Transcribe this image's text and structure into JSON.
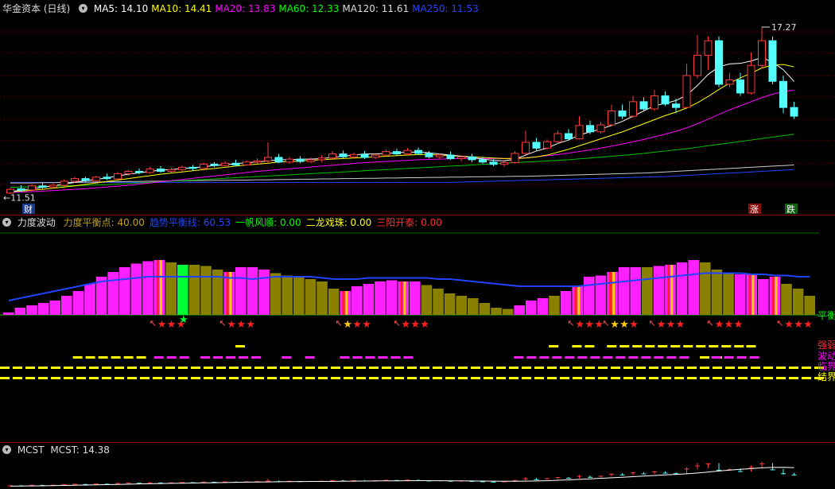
{
  "main": {
    "title": "华金资本 (日线)",
    "ma": [
      {
        "label": "MA5: 14.10",
        "color": "#ffffff"
      },
      {
        "label": "MA10: 14.41",
        "color": "#ffff00"
      },
      {
        "label": "MA20: 13.83",
        "color": "#ff00ff"
      },
      {
        "label": "MA60: 12.33",
        "color": "#00ff00"
      },
      {
        "label": "MA120: 11.61",
        "color": "#dddddd"
      },
      {
        "label": "MA250: 11.53",
        "color": "#2244ff"
      }
    ],
    "high_label": "17.27",
    "low_label": "11.51",
    "markers": {
      "cai": "财",
      "zhang": "涨",
      "die": "跌"
    },
    "candles": [
      [
        11.55,
        11.72,
        11.68,
        11.51
      ],
      [
        11.7,
        11.82,
        11.65,
        11.6
      ],
      [
        11.66,
        11.85,
        11.8,
        11.62
      ],
      [
        11.8,
        11.92,
        11.75,
        11.7
      ],
      [
        11.76,
        11.88,
        11.82,
        11.7
      ],
      [
        11.82,
        12.02,
        11.96,
        11.78
      ],
      [
        11.96,
        12.1,
        12.05,
        11.9
      ],
      [
        12.05,
        12.12,
        11.98,
        11.92
      ],
      [
        11.98,
        12.15,
        12.1,
        11.95
      ],
      [
        12.1,
        12.22,
        12.05,
        12.0
      ],
      [
        12.04,
        12.28,
        12.22,
        12.02
      ],
      [
        12.22,
        12.35,
        12.3,
        12.15
      ],
      [
        12.3,
        12.4,
        12.26,
        12.2
      ],
      [
        12.26,
        12.45,
        12.38,
        12.22
      ],
      [
        12.38,
        12.48,
        12.3,
        12.25
      ],
      [
        12.3,
        12.42,
        12.36,
        12.26
      ],
      [
        12.36,
        12.5,
        12.44,
        12.3
      ],
      [
        12.44,
        12.52,
        12.4,
        12.32
      ],
      [
        12.4,
        12.6,
        12.55,
        12.36
      ],
      [
        12.55,
        12.62,
        12.5,
        12.44
      ],
      [
        12.5,
        12.65,
        12.58,
        12.46
      ],
      [
        12.58,
        12.7,
        12.52,
        12.48
      ],
      [
        12.52,
        12.68,
        12.62,
        12.5
      ],
      [
        12.62,
        12.75,
        12.66,
        12.55
      ],
      [
        12.66,
        13.3,
        12.78,
        12.6
      ],
      [
        12.78,
        12.9,
        12.62,
        12.58
      ],
      [
        12.62,
        12.8,
        12.72,
        12.56
      ],
      [
        12.72,
        12.82,
        12.64,
        12.58
      ],
      [
        12.64,
        12.78,
        12.7,
        12.58
      ],
      [
        12.7,
        12.85,
        12.76,
        12.62
      ],
      [
        12.76,
        13.0,
        12.9,
        12.7
      ],
      [
        12.9,
        13.02,
        12.8,
        12.74
      ],
      [
        12.8,
        12.95,
        12.88,
        12.74
      ],
      [
        12.88,
        13.0,
        12.78,
        12.72
      ],
      [
        12.78,
        12.92,
        12.86,
        12.72
      ],
      [
        12.86,
        13.05,
        12.98,
        12.8
      ],
      [
        12.98,
        13.08,
        12.9,
        12.84
      ],
      [
        12.9,
        13.1,
        13.02,
        12.86
      ],
      [
        13.02,
        13.12,
        12.92,
        12.86
      ],
      [
        12.92,
        13.0,
        12.8,
        12.74
      ],
      [
        12.8,
        12.92,
        12.86,
        12.72
      ],
      [
        12.86,
        12.98,
        12.74,
        12.7
      ],
      [
        12.74,
        12.86,
        12.8,
        12.64
      ],
      [
        12.8,
        12.9,
        12.7,
        12.62
      ],
      [
        12.7,
        12.8,
        12.62,
        12.56
      ],
      [
        12.62,
        12.72,
        12.54,
        12.48
      ],
      [
        12.54,
        12.64,
        12.6,
        12.46
      ],
      [
        12.6,
        13.0,
        12.92,
        12.56
      ],
      [
        12.92,
        13.7,
        13.3,
        12.88
      ],
      [
        13.3,
        13.45,
        13.1,
        13.02
      ],
      [
        13.1,
        13.4,
        13.32,
        13.05
      ],
      [
        13.32,
        13.7,
        13.6,
        13.25
      ],
      [
        13.6,
        13.75,
        13.42,
        13.35
      ],
      [
        13.42,
        14.2,
        13.88,
        13.4
      ],
      [
        13.88,
        14.05,
        13.66,
        13.58
      ],
      [
        13.66,
        14.0,
        13.9,
        13.6
      ],
      [
        13.9,
        14.6,
        14.38,
        13.85
      ],
      [
        14.38,
        14.6,
        14.2,
        14.1
      ],
      [
        14.2,
        14.9,
        14.7,
        14.15
      ],
      [
        14.7,
        14.85,
        14.45,
        14.38
      ],
      [
        14.45,
        15.1,
        14.9,
        14.4
      ],
      [
        14.9,
        15.05,
        14.62,
        14.55
      ],
      [
        14.62,
        14.8,
        14.5,
        14.3
      ],
      [
        14.5,
        16.0,
        15.6,
        14.45
      ],
      [
        15.6,
        17.0,
        16.3,
        15.5
      ],
      [
        16.3,
        16.95,
        16.8,
        15.8
      ],
      [
        16.8,
        16.95,
        15.3,
        15.2
      ],
      [
        15.3,
        15.7,
        15.45,
        15.2
      ],
      [
        15.45,
        15.7,
        15.0,
        14.9
      ],
      [
        15.0,
        16.4,
        15.95,
        14.95
      ],
      [
        15.95,
        17.27,
        16.8,
        15.85
      ],
      [
        16.8,
        16.95,
        15.4,
        15.3
      ],
      [
        15.4,
        15.6,
        14.5,
        14.3
      ],
      [
        14.5,
        14.7,
        14.2,
        14.1
      ]
    ],
    "ma5": [
      11.6,
      11.65,
      11.7,
      11.75,
      11.8,
      11.86,
      11.92,
      11.98,
      12.02,
      12.08,
      12.14,
      12.2,
      12.25,
      12.3,
      12.34,
      12.36,
      12.4,
      12.42,
      12.46,
      12.5,
      12.53,
      12.56,
      12.6,
      12.62,
      12.66,
      12.7,
      12.7,
      12.72,
      12.72,
      12.74,
      12.78,
      12.82,
      12.86,
      12.9,
      12.9,
      12.92,
      12.94,
      12.96,
      12.96,
      12.94,
      12.9,
      12.86,
      12.82,
      12.78,
      12.72,
      12.68,
      12.66,
      12.72,
      12.86,
      13.0,
      13.1,
      13.26,
      13.38,
      13.55,
      13.66,
      13.76,
      13.88,
      14.02,
      14.2,
      14.38,
      14.56,
      14.64,
      14.74,
      14.92,
      15.26,
      15.64,
      15.9,
      16.0,
      16.02,
      16.1,
      16.22,
      16.06,
      15.8,
      15.4
    ],
    "ma10": [
      11.6,
      11.62,
      11.65,
      11.68,
      11.72,
      11.76,
      11.8,
      11.85,
      11.9,
      11.95,
      12.0,
      12.05,
      12.1,
      12.15,
      12.2,
      12.24,
      12.28,
      12.32,
      12.36,
      12.4,
      12.44,
      12.48,
      12.52,
      12.55,
      12.58,
      12.62,
      12.64,
      12.66,
      12.68,
      12.7,
      12.72,
      12.74,
      12.76,
      12.78,
      12.8,
      12.82,
      12.84,
      12.86,
      12.88,
      12.88,
      12.86,
      12.84,
      12.82,
      12.8,
      12.78,
      12.76,
      12.74,
      12.74,
      12.76,
      12.8,
      12.86,
      12.96,
      13.06,
      13.18,
      13.3,
      13.42,
      13.54,
      13.66,
      13.8,
      13.94,
      14.08,
      14.22,
      14.34,
      14.48,
      14.66,
      14.88,
      15.12,
      15.34,
      15.52,
      15.68,
      15.86,
      15.96,
      15.98,
      15.9
    ],
    "ma20": [
      11.58,
      11.59,
      11.6,
      11.62,
      11.64,
      11.66,
      11.68,
      11.7,
      11.73,
      11.76,
      11.79,
      11.82,
      11.86,
      11.9,
      11.94,
      11.98,
      12.02,
      12.06,
      12.1,
      12.14,
      12.18,
      12.22,
      12.26,
      12.3,
      12.33,
      12.36,
      12.39,
      12.42,
      12.45,
      12.48,
      12.51,
      12.54,
      12.57,
      12.6,
      12.62,
      12.64,
      12.66,
      12.68,
      12.7,
      12.71,
      12.72,
      12.73,
      12.74,
      12.74,
      12.74,
      12.74,
      12.74,
      12.75,
      12.77,
      12.8,
      12.84,
      12.88,
      12.93,
      12.98,
      13.04,
      13.1,
      13.17,
      13.24,
      13.32,
      13.4,
      13.49,
      13.58,
      13.68,
      13.8,
      13.94,
      14.1,
      14.26,
      14.42,
      14.56,
      14.7,
      14.84,
      14.96,
      15.04,
      15.1
    ],
    "ma60": [
      11.75,
      11.76,
      11.77,
      11.78,
      11.79,
      11.8,
      11.81,
      11.82,
      11.83,
      11.84,
      11.86,
      11.88,
      11.9,
      11.92,
      11.94,
      11.96,
      11.98,
      12.0,
      12.02,
      12.04,
      12.06,
      12.08,
      12.1,
      12.12,
      12.14,
      12.16,
      12.18,
      12.2,
      12.22,
      12.24,
      12.26,
      12.28,
      12.3,
      12.32,
      12.34,
      12.36,
      12.38,
      12.4,
      12.42,
      12.44,
      12.46,
      12.48,
      12.5,
      12.52,
      12.54,
      12.56,
      12.58,
      12.6,
      12.62,
      12.64,
      12.66,
      12.68,
      12.7,
      12.73,
      12.76,
      12.79,
      12.82,
      12.85,
      12.88,
      12.92,
      12.96,
      13.0,
      13.04,
      13.08,
      13.13,
      13.18,
      13.23,
      13.28,
      13.33,
      13.38,
      13.43,
      13.48,
      13.53,
      13.58
    ],
    "ma120": [
      11.9,
      11.9,
      11.9,
      11.91,
      11.91,
      11.92,
      11.92,
      11.93,
      11.93,
      11.94,
      11.94,
      11.95,
      11.95,
      11.96,
      11.96,
      11.97,
      11.97,
      11.98,
      11.98,
      11.99,
      11.99,
      12.0,
      12.0,
      12.01,
      12.01,
      12.02,
      12.02,
      12.03,
      12.03,
      12.04,
      12.04,
      12.05,
      12.05,
      12.06,
      12.06,
      12.07,
      12.07,
      12.08,
      12.08,
      12.09,
      12.09,
      12.1,
      12.1,
      12.11,
      12.11,
      12.12,
      12.12,
      12.13,
      12.13,
      12.14,
      12.15,
      12.16,
      12.17,
      12.18,
      12.19,
      12.2,
      12.21,
      12.22,
      12.23,
      12.24,
      12.26,
      12.28,
      12.3,
      12.32,
      12.34,
      12.36,
      12.38,
      12.4,
      12.42,
      12.44,
      12.46,
      12.48,
      12.5,
      12.52
    ],
    "ma250": [
      11.92,
      11.92,
      11.92,
      11.92,
      11.92,
      11.92,
      11.92,
      11.92,
      11.92,
      11.92,
      11.92,
      11.92,
      11.92,
      11.92,
      11.92,
      11.92,
      11.92,
      11.92,
      11.92,
      11.92,
      11.92,
      11.92,
      11.92,
      11.92,
      11.92,
      11.92,
      11.92,
      11.92,
      11.92,
      11.92,
      11.92,
      11.92,
      11.92,
      11.92,
      11.92,
      11.92,
      11.92,
      11.92,
      11.92,
      11.92,
      11.92,
      11.92,
      11.93,
      11.94,
      11.95,
      11.96,
      11.97,
      11.98,
      11.99,
      12.0,
      12.01,
      12.02,
      12.03,
      12.04,
      12.05,
      12.06,
      12.07,
      12.08,
      12.09,
      12.1,
      12.11,
      12.12,
      12.14,
      12.16,
      12.18,
      12.2,
      12.22,
      12.24,
      12.26,
      12.28,
      12.3,
      12.32,
      12.34,
      12.36
    ],
    "price_range": [
      11.3,
      17.6
    ]
  },
  "mid": {
    "title": "力度波动",
    "legend": [
      {
        "label": "力度平衡点: 40.00",
        "color": "#c0a020"
      },
      {
        "label": "趋势平衡线: 60.53",
        "color": "#2244ff"
      },
      {
        "label": "一帆风顺: 0.00",
        "color": "#00ff00"
      },
      {
        "label": "二龙戏珠: 0.00",
        "color": "#ffff00"
      },
      {
        "label": "三阳开泰: 0.00",
        "color": "#ff3030"
      }
    ],
    "right_labels": [
      {
        "text": "平衡",
        "color": "#00ff00"
      },
      {
        "text": "强弱",
        "color": "#ff3030"
      },
      {
        "text": "波动",
        "color": "#ff00ff"
      },
      {
        "text": "临界",
        "color": "#ff00ff"
      },
      {
        "text": "结界",
        "color": "#ffff00"
      }
    ],
    "bars": [
      {
        "v": 2,
        "c": "m"
      },
      {
        "v": 6,
        "c": "m"
      },
      {
        "v": 8,
        "c": "m"
      },
      {
        "v": 10,
        "c": "m"
      },
      {
        "v": 12,
        "c": "m"
      },
      {
        "v": 16,
        "c": "m"
      },
      {
        "v": 20,
        "c": "m"
      },
      {
        "v": 26,
        "c": "m"
      },
      {
        "v": 32,
        "c": "m"
      },
      {
        "v": 36,
        "c": "m"
      },
      {
        "v": 40,
        "c": "m"
      },
      {
        "v": 43,
        "c": "m"
      },
      {
        "v": 45,
        "c": "m"
      },
      {
        "v": 46,
        "c": "r"
      },
      {
        "v": 44,
        "c": "o"
      },
      {
        "v": 42,
        "c": "g"
      },
      {
        "v": 42,
        "c": "o"
      },
      {
        "v": 41,
        "c": "o"
      },
      {
        "v": 38,
        "c": "o"
      },
      {
        "v": 36,
        "c": "r"
      },
      {
        "v": 40,
        "c": "m"
      },
      {
        "v": 40,
        "c": "m"
      },
      {
        "v": 38,
        "c": "m"
      },
      {
        "v": 35,
        "c": "o"
      },
      {
        "v": 33,
        "c": "o"
      },
      {
        "v": 32,
        "c": "o"
      },
      {
        "v": 30,
        "c": "o"
      },
      {
        "v": 28,
        "c": "o"
      },
      {
        "v": 22,
        "c": "o"
      },
      {
        "v": 20,
        "c": "r"
      },
      {
        "v": 24,
        "c": "m"
      },
      {
        "v": 26,
        "c": "m"
      },
      {
        "v": 28,
        "c": "m"
      },
      {
        "v": 29,
        "c": "m"
      },
      {
        "v": 28,
        "c": "r"
      },
      {
        "v": 28,
        "c": "m"
      },
      {
        "v": 25,
        "c": "o"
      },
      {
        "v": 22,
        "c": "o"
      },
      {
        "v": 18,
        "c": "o"
      },
      {
        "v": 16,
        "c": "o"
      },
      {
        "v": 14,
        "c": "o"
      },
      {
        "v": 10,
        "c": "o"
      },
      {
        "v": 6,
        "c": "o"
      },
      {
        "v": 5,
        "c": "o"
      },
      {
        "v": 8,
        "c": "m"
      },
      {
        "v": 12,
        "c": "m"
      },
      {
        "v": 14,
        "c": "m"
      },
      {
        "v": 16,
        "c": "o"
      },
      {
        "v": 20,
        "c": "m"
      },
      {
        "v": 24,
        "c": "r"
      },
      {
        "v": 32,
        "c": "m"
      },
      {
        "v": 33,
        "c": "m"
      },
      {
        "v": 36,
        "c": "r"
      },
      {
        "v": 40,
        "c": "m"
      },
      {
        "v": 40,
        "c": "m"
      },
      {
        "v": 40,
        "c": "o"
      },
      {
        "v": 41,
        "c": "m"
      },
      {
        "v": 42,
        "c": "r"
      },
      {
        "v": 44,
        "c": "m"
      },
      {
        "v": 46,
        "c": "m"
      },
      {
        "v": 44,
        "c": "o"
      },
      {
        "v": 38,
        "c": "o"
      },
      {
        "v": 35,
        "c": "o"
      },
      {
        "v": 34,
        "c": "m"
      },
      {
        "v": 34,
        "c": "r"
      },
      {
        "v": 30,
        "c": "m"
      },
      {
        "v": 32,
        "c": "r"
      },
      {
        "v": 26,
        "c": "o"
      },
      {
        "v": 22,
        "c": "o"
      },
      {
        "v": 16,
        "c": "o"
      }
    ],
    "trend": [
      12,
      14,
      16,
      18,
      20,
      22,
      24,
      26,
      28,
      29,
      30,
      31,
      32,
      32,
      32,
      32,
      32,
      32,
      32,
      31,
      31,
      30,
      31,
      32,
      32,
      32,
      32,
      31,
      30,
      30,
      30,
      31,
      31,
      31,
      31,
      31,
      31,
      30,
      30,
      29,
      28,
      27,
      26,
      25,
      24,
      24,
      24,
      24,
      24,
      24,
      25,
      26,
      27,
      28,
      29,
      30,
      31,
      32,
      33,
      34,
      35,
      35,
      35,
      35,
      34,
      34,
      33,
      33,
      32,
      32
    ],
    "level_range": [
      0,
      60
    ],
    "signals": [
      13,
      19,
      29,
      34,
      49,
      52,
      56,
      61,
      67
    ],
    "green_star_at": 15,
    "dashes": {
      "row1": [
        [
          20,
          21
        ],
        [
          47,
          48
        ],
        [
          49,
          51
        ],
        [
          52,
          63
        ],
        [
          64,
          65
        ]
      ],
      "row2": [
        [
          6,
          12,
          "y"
        ],
        [
          13,
          16,
          "m"
        ],
        [
          17,
          22,
          "m"
        ],
        [
          24,
          25,
          "m"
        ],
        [
          26,
          27,
          "m"
        ],
        [
          29,
          35,
          "m"
        ],
        [
          44,
          59,
          "m"
        ],
        [
          60,
          62,
          "y"
        ],
        [
          61,
          65,
          "m"
        ]
      ]
    }
  },
  "bottom": {
    "title": "MCST",
    "value": "MCST: 14.38"
  }
}
